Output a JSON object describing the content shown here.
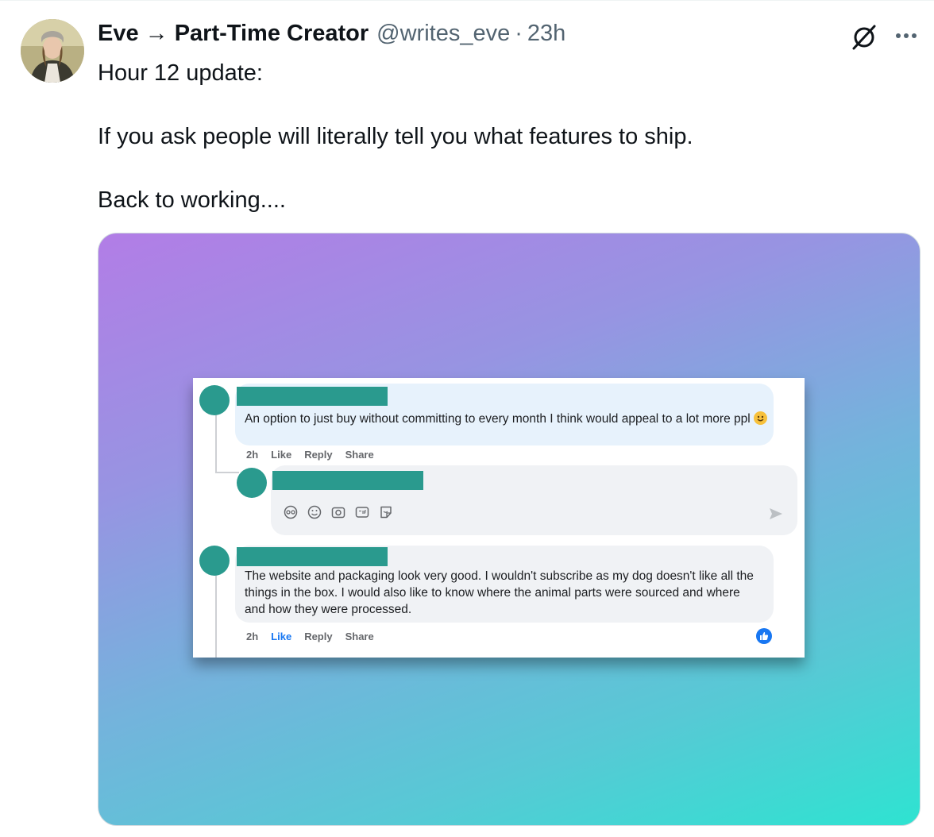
{
  "tweet": {
    "author_name": "Eve → Part-Time Creator",
    "handle": "@writes_eve",
    "separator": "·",
    "time": "23h",
    "lines": [
      "Hour 12 update:",
      "If you ask people will literally tell you what features to ship.",
      "Back to working...."
    ]
  },
  "icons": {
    "grok": "grok-icon",
    "more": "more-icon"
  },
  "media": {
    "gradient_colors": [
      "#b27de6",
      "#74b3dc",
      "#2ee3d1"
    ],
    "comments": [
      {
        "text": "An option to just buy without committing to every month I think would appeal to a lot more ppl",
        "emoji": "smiling-face-emoji",
        "time": "2h",
        "like": "Like",
        "reply": "Reply",
        "share": "Share",
        "liked": false
      },
      {
        "text": "The website and packaging look very good. I wouldn't subscribe as my dog doesn't like all the things in the box. I would also like to know where the animal parts were sourced and where and how they were processed.",
        "time": "2h",
        "like": "Like",
        "reply": "Reply",
        "share": "Share",
        "liked": true
      }
    ],
    "composer_tools": [
      "avatar-sticker-icon",
      "emoji-icon",
      "camera-icon",
      "gif-icon",
      "sticker-icon"
    ],
    "send_icon": "send-icon",
    "accent": "#1877f2",
    "redaction_color": "#2a9a8e"
  }
}
